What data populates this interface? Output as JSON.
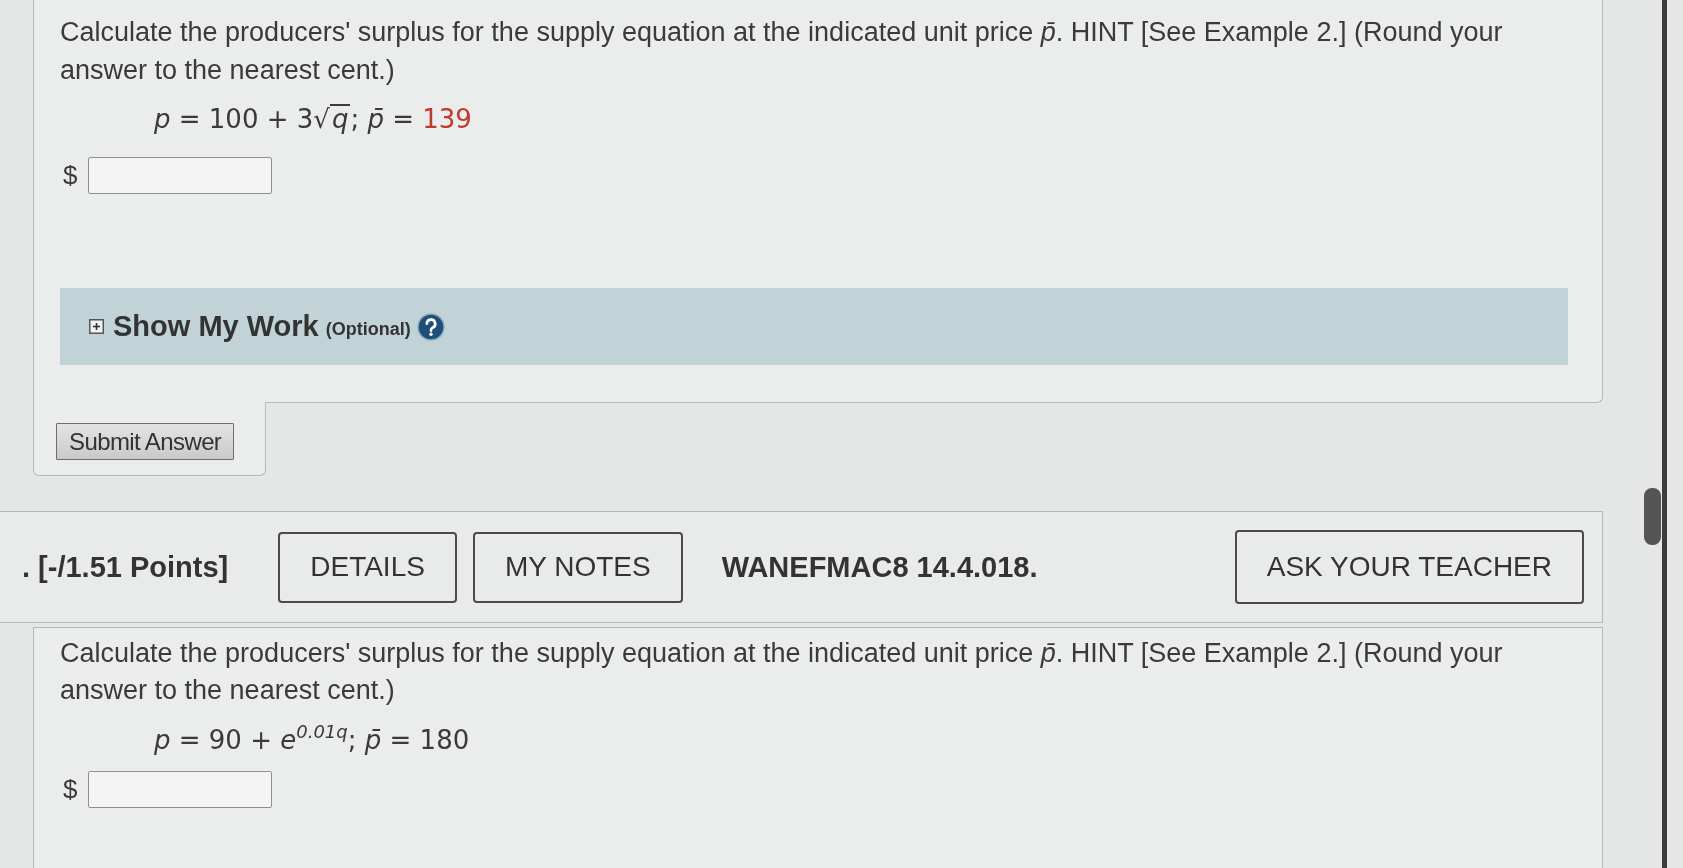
{
  "questions": [
    {
      "prompt": "Calculate the producers' surplus for the supply equation at the indicated unit price *p̄*. HINT [See Example 2.] (Round your answer to the nearest cent.)",
      "equation": [
        {
          "kind": "var",
          "text": "p"
        },
        {
          "kind": "text",
          "text": " = 100 + 3"
        },
        {
          "kind": "sqrt",
          "sign": "√",
          "text": "q"
        },
        {
          "kind": "text",
          "text": "; "
        },
        {
          "kind": "var",
          "text": "p̄"
        },
        {
          "kind": "text",
          "text": " = "
        },
        {
          "kind": "value",
          "text": "139"
        }
      ],
      "answer": {
        "prefix": "$"
      },
      "show_my_work": {
        "label": "Show My Work",
        "note": "(Optional)",
        "expanded": false
      },
      "submit_button": "Submit Answer"
    },
    {
      "header": {
        "points": ". [-/1.51 Points]",
        "buttons": [
          {
            "label": "DETAILS"
          },
          {
            "label": "MY NOTES"
          }
        ],
        "code": "WANEFMAC8 14.4.018.",
        "ask_button": "ASK YOUR TEACHER"
      },
      "prompt": "Calculate the producers' surplus for the supply equation at the indicated unit price *p̄*. HINT [See Example 2.] (Round your answer to the nearest cent.)",
      "equation": [
        {
          "kind": "var",
          "text": "p"
        },
        {
          "kind": "text",
          "text": " = 90 + "
        },
        {
          "kind": "var",
          "text": "e"
        },
        {
          "kind": "power",
          "text": "0.01q"
        },
        {
          "kind": "text",
          "text": "; "
        },
        {
          "kind": "var",
          "text": "p̄"
        },
        {
          "kind": "text",
          "text": " = 180"
        }
      ],
      "answer": {
        "prefix": "$"
      }
    }
  ]
}
